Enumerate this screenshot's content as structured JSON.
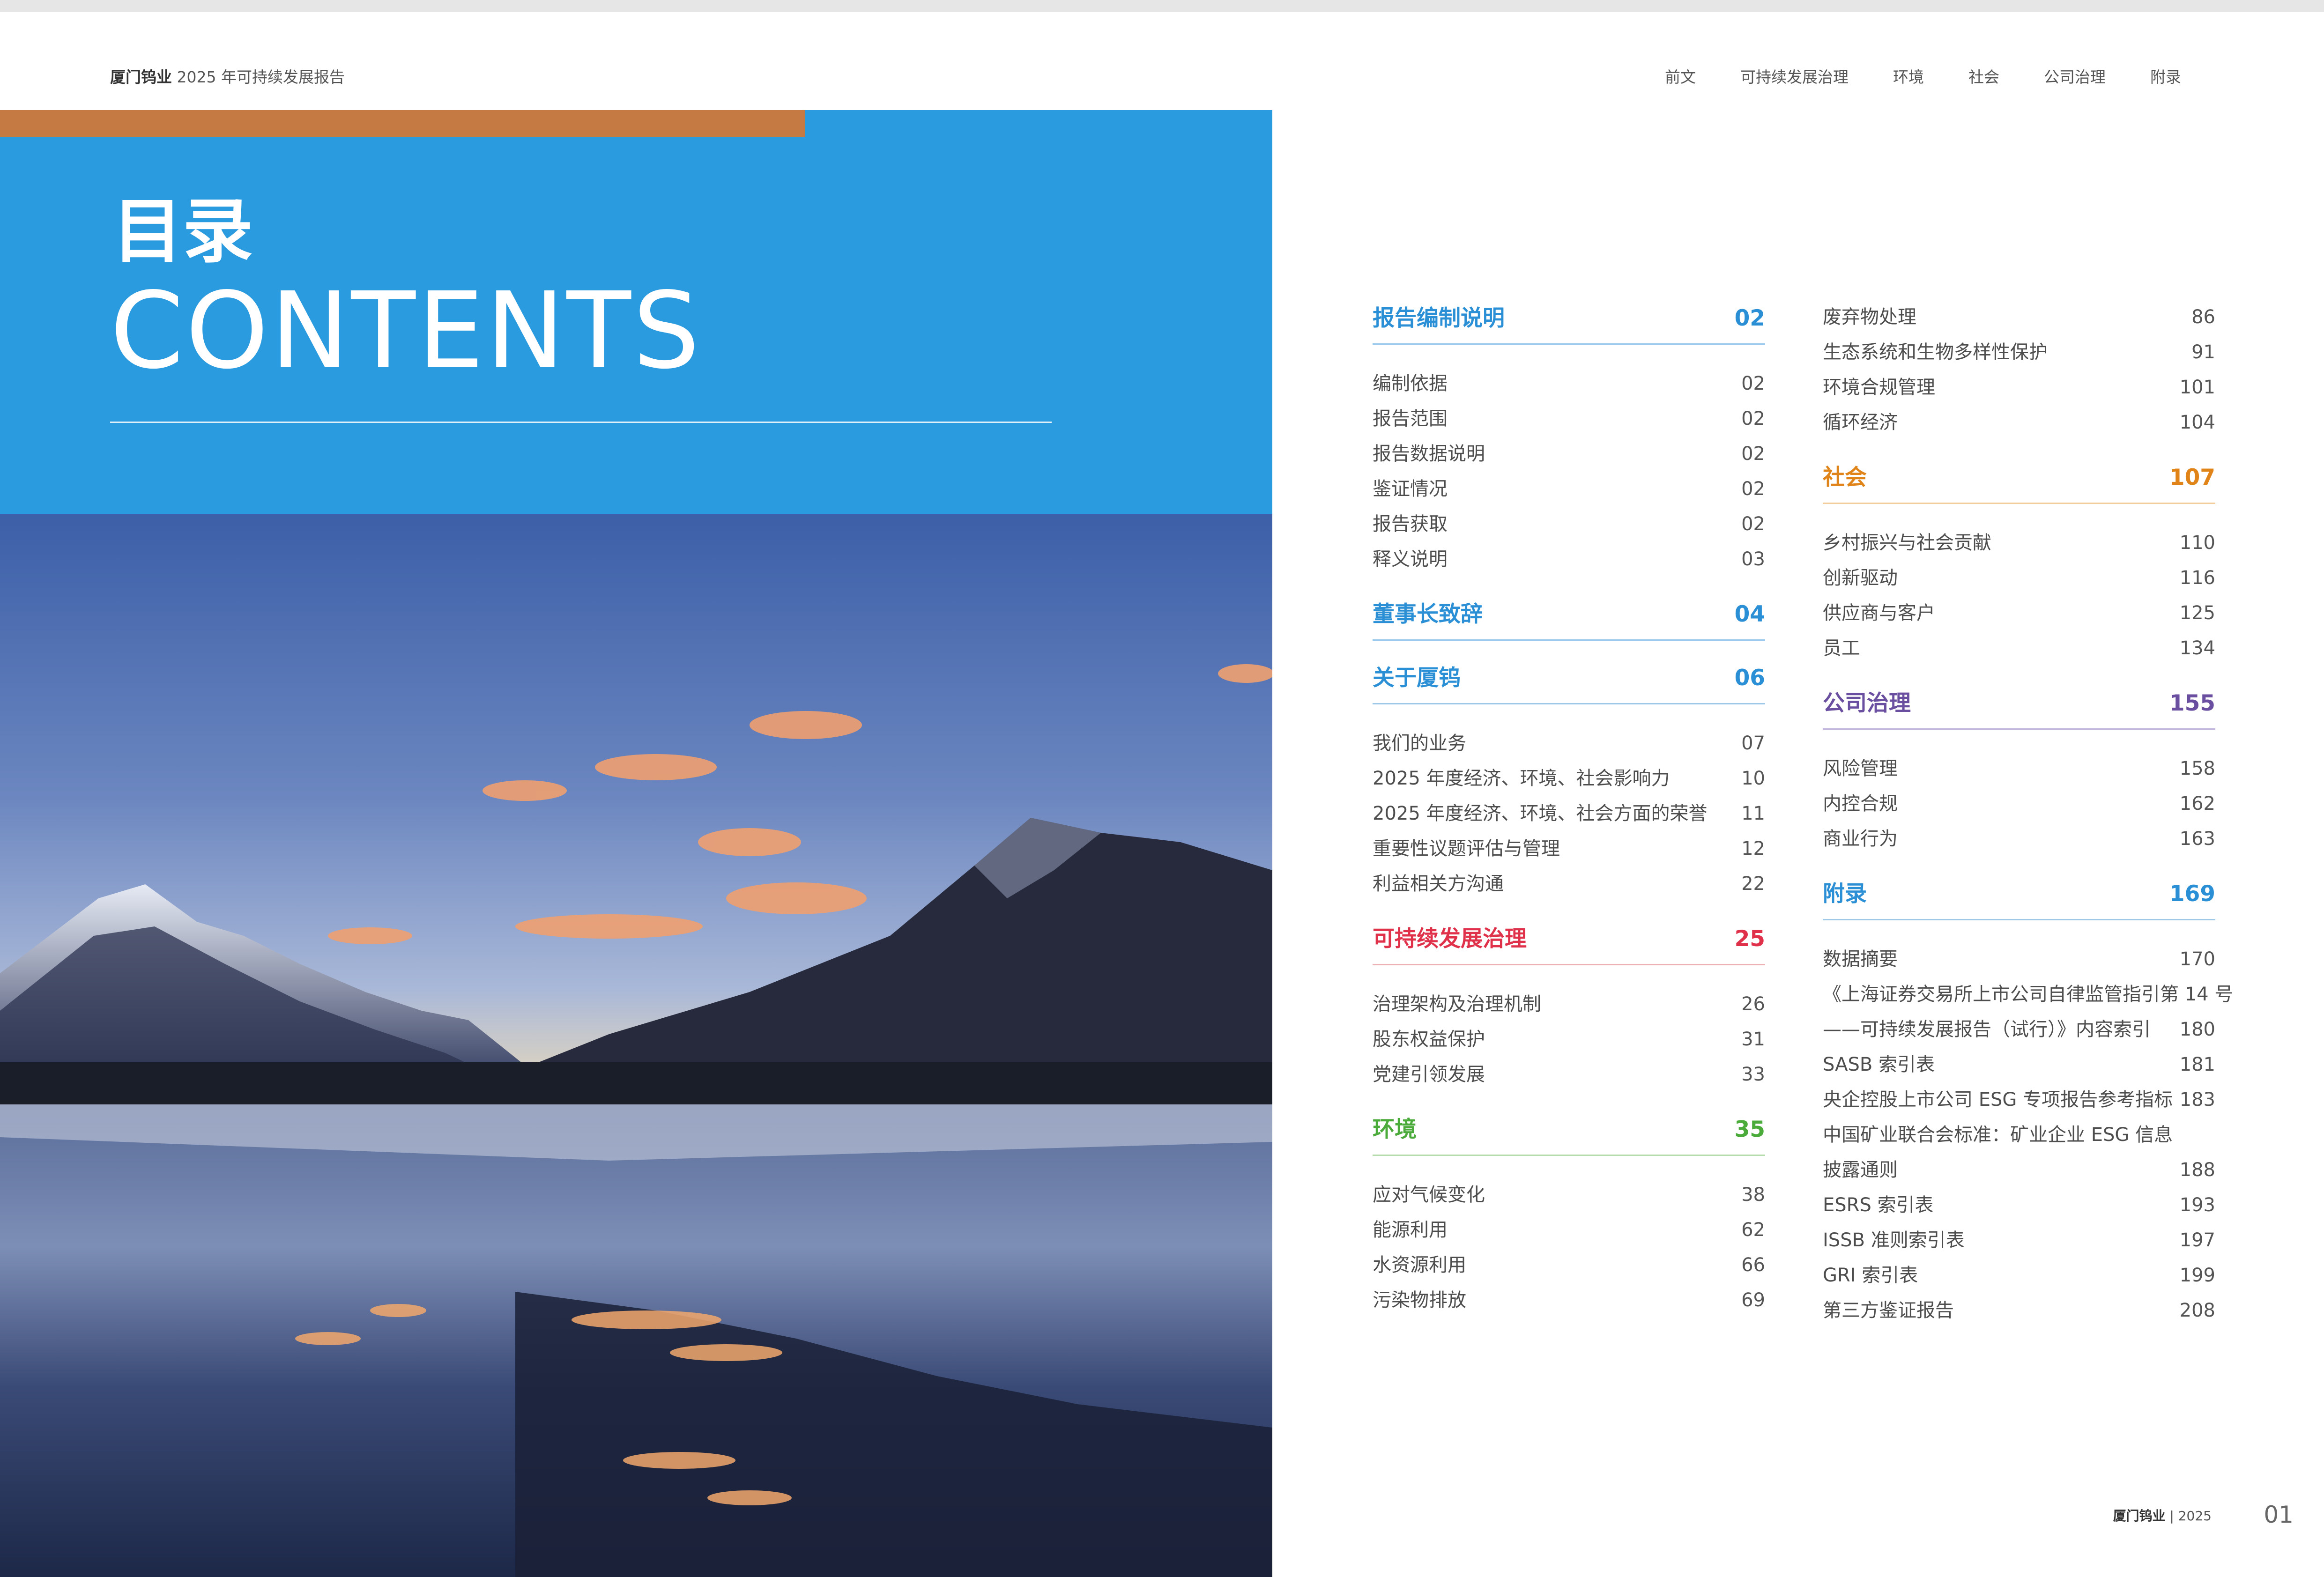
{
  "header": {
    "brand": "厦门钨业",
    "report": "2025 年可持续发展报告",
    "nav": [
      "前文",
      "可持续发展治理",
      "环境",
      "社会",
      "公司治理",
      "附录"
    ]
  },
  "title": {
    "zh": "目录",
    "en": "CONTENTS"
  },
  "colors": {
    "blue": "#2b9be0",
    "orange_band": "#c57a44",
    "red": "#e0314b",
    "green": "#4aaa3a",
    "orange": "#e0841a",
    "purple": "#6a4fa0"
  },
  "toc": {
    "col1": [
      {
        "title": "报告编制说明",
        "page": "02",
        "color": "#2b8fd6",
        "items": [
          [
            "编制依据",
            "02"
          ],
          [
            "报告范围",
            "02"
          ],
          [
            "报告数据说明",
            "02"
          ],
          [
            "鉴证情况",
            "02"
          ],
          [
            "报告获取",
            "02"
          ],
          [
            "释义说明",
            "03"
          ]
        ]
      },
      {
        "title": "董事长致辞",
        "page": "04",
        "color": "#2b8fd6",
        "items": []
      },
      {
        "title": "关于厦钨",
        "page": "06",
        "color": "#2b8fd6",
        "items": [
          [
            "我们的业务",
            "07"
          ],
          [
            "2025 年度经济、环境、社会影响力",
            "10"
          ],
          [
            "2025 年度经济、环境、社会方面的荣誉",
            "11"
          ],
          [
            "重要性议题评估与管理",
            "12"
          ],
          [
            "利益相关方沟通",
            "22"
          ]
        ]
      },
      {
        "title": "可持续发展治理",
        "page": "25",
        "color": "#e0314b",
        "items": [
          [
            "治理架构及治理机制",
            "26"
          ],
          [
            "股东权益保护",
            "31"
          ],
          [
            "党建引领发展",
            "33"
          ]
        ]
      },
      {
        "title": "环境",
        "page": "35",
        "color": "#4aaa3a",
        "items": [
          [
            "应对气候变化",
            "38"
          ],
          [
            "能源利用",
            "62"
          ],
          [
            "水资源利用",
            "66"
          ],
          [
            "污染物排放",
            "69"
          ]
        ]
      }
    ],
    "col2_plain": [
      [
        "废弃物处理",
        "86"
      ],
      [
        "生态系统和生物多样性保护",
        "91"
      ],
      [
        "环境合规管理",
        "101"
      ],
      [
        "循环经济",
        "104"
      ]
    ],
    "col2": [
      {
        "title": "社会",
        "page": "107",
        "color": "#e0841a",
        "items": [
          [
            "乡村振兴与社会贡献",
            "110"
          ],
          [
            "创新驱动",
            "116"
          ],
          [
            "供应商与客户",
            "125"
          ],
          [
            "员工",
            "134"
          ]
        ]
      },
      {
        "title": "公司治理",
        "page": "155",
        "color": "#6a4fa0",
        "items": [
          [
            "风险管理",
            "158"
          ],
          [
            "内控合规",
            "162"
          ],
          [
            "商业行为",
            "163"
          ]
        ]
      },
      {
        "title": "附录",
        "page": "169",
        "color": "#2b8fd6",
        "items": [
          [
            "数据摘要",
            "170"
          ],
          [
            "《上海证券交易所上市公司自律监管指引第 14 号",
            ""
          ],
          [
            "——可持续发展报告（试行）》内容索引",
            "180"
          ],
          [
            "SASB 索引表",
            "181"
          ],
          [
            "央企控股上市公司 ESG 专项报告参考指标",
            "183"
          ],
          [
            "中国矿业联合会标准：矿业企业 ESG 信息",
            ""
          ],
          [
            "披露通则",
            "188"
          ],
          [
            "ESRS 索引表",
            "193"
          ],
          [
            "ISSB 准则索引表",
            "197"
          ],
          [
            "GRI 索引表",
            "199"
          ],
          [
            "第三方鉴证报告",
            "208"
          ]
        ]
      }
    ]
  },
  "footer": {
    "brand": "厦门钨业",
    "year": "2025",
    "page": "01"
  }
}
